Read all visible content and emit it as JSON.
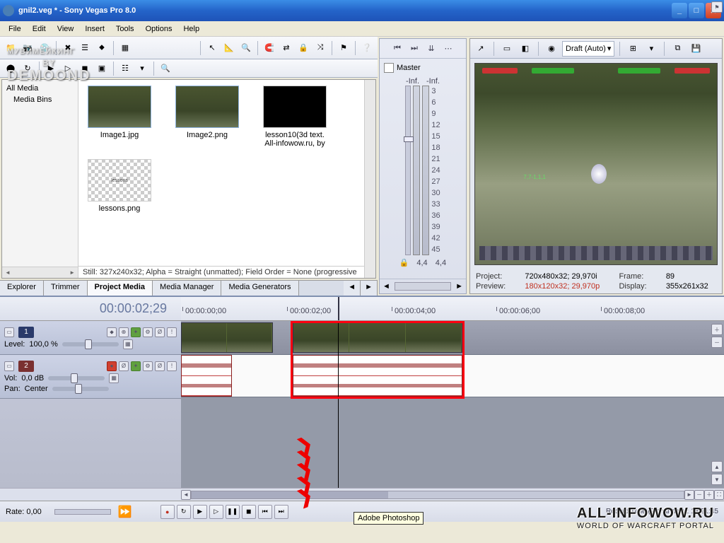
{
  "title": "gnil2.veg * - Sony Vegas Pro 8.0",
  "menu": [
    "File",
    "Edit",
    "View",
    "Insert",
    "Tools",
    "Options",
    "Help"
  ],
  "mediaTree": {
    "root": "All Media",
    "sub": "Media Bins"
  },
  "thumbs": [
    {
      "label": "Image1.jpg",
      "kind": "game"
    },
    {
      "label": "Image2.png",
      "kind": "game"
    },
    {
      "label": "lesson10(3d text. All-infowow.ru, by",
      "kind": "black"
    },
    {
      "label": "lessons.png",
      "kind": "checker"
    }
  ],
  "mediaStatus": "Still: 327x240x32; Alpha = Straight (unmatted); Field Order = None (progressive",
  "tabs": [
    "Explorer",
    "Trimmer",
    "Project Media",
    "Media Manager",
    "Media Generators"
  ],
  "activeTab": "Project Media",
  "meter": {
    "title": "Master",
    "topL": "-Inf.",
    "topR": "-Inf.",
    "scale": [
      "3",
      "6",
      "9",
      "12",
      "15",
      "18",
      "21",
      "24",
      "27",
      "30",
      "33",
      "36",
      "39",
      "42",
      "45"
    ],
    "valL": "4,4",
    "valR": "4,4"
  },
  "preview": {
    "quality": "Draft (Auto)",
    "info": {
      "project_label": "Project:",
      "project_val": "720x480x32; 29,970i",
      "frame_label": "Frame:",
      "frame_val": "89",
      "preview_label": "Preview:",
      "preview_val": "180x120x32; 29,970p",
      "display_label": "Display:",
      "display_val": "355x261x32"
    }
  },
  "timecode": "00:00:02;29",
  "rulerMarks": [
    "00:00:00;00",
    "00:00:02;00",
    "00:00:04;00",
    "00:00:06;00",
    "00:00:08;00"
  ],
  "track1": {
    "num": "1",
    "level_label": "Level:",
    "level_val": "100,0 %"
  },
  "track2": {
    "num": "2",
    "vol_label": "Vol:",
    "vol_val": "0,0 dB",
    "pan_label": "Pan:",
    "pan_val": "Center"
  },
  "rate": {
    "label": "Rate:",
    "val": "0,00"
  },
  "tooltip": "Adobe Photoshop",
  "recordTime": "Record Time (2 channels): 18:21:45",
  "watermark": {
    "line1": "МУВИМЕЙКИНГ",
    "by": "BY",
    "brand": "DEMOOND"
  },
  "portal": {
    "line1": "ALL-INFOWOW.RU",
    "line2": "WORLD OF WARCRAFT PORTAL"
  }
}
